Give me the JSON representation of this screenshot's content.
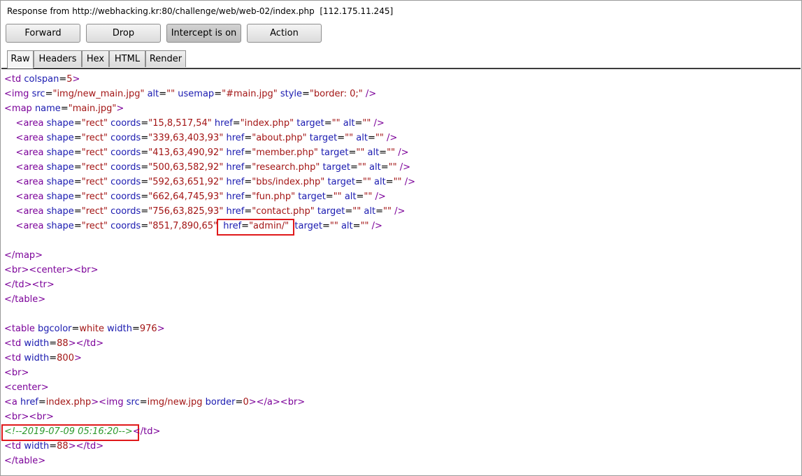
{
  "header": {
    "title": "Response from http://webhacking.kr:80/challenge/web/web-02/index.php  [112.175.11.245]"
  },
  "toolbar": {
    "forward": "Forward",
    "drop": "Drop",
    "intercept": "Intercept is on",
    "action": "Action"
  },
  "tabs": [
    "Raw",
    "Headers",
    "Hex",
    "HTML",
    "Render"
  ],
  "active_tab": "Raw",
  "colors": {
    "tag": "#7b0099",
    "attr_name": "#1a1ab0",
    "attr_value": "#a31515",
    "comment": "#2e9a2e",
    "highlight_border": "#e0191b"
  },
  "code_lines": [
    [
      [
        "tg",
        "<"
      ],
      [
        "tg",
        "td"
      ],
      [
        "tx",
        " "
      ],
      [
        "an",
        "colspan"
      ],
      [
        "tx",
        "="
      ],
      [
        "av",
        "5"
      ],
      [
        "tg",
        ">"
      ]
    ],
    [
      [
        "tg",
        "<"
      ],
      [
        "tg",
        "img"
      ],
      [
        "tx",
        " "
      ],
      [
        "an",
        "src"
      ],
      [
        "tx",
        "="
      ],
      [
        "av",
        "\"img/new_main.jpg\""
      ],
      [
        "tx",
        " "
      ],
      [
        "an",
        "alt"
      ],
      [
        "tx",
        "="
      ],
      [
        "av",
        "\"\""
      ],
      [
        "tx",
        " "
      ],
      [
        "an",
        "usemap"
      ],
      [
        "tx",
        "="
      ],
      [
        "av",
        "\"#main.jpg\""
      ],
      [
        "tx",
        " "
      ],
      [
        "an",
        "style"
      ],
      [
        "tx",
        "="
      ],
      [
        "av",
        "\"border: 0;\""
      ],
      [
        "tx",
        " "
      ],
      [
        "tg",
        "/>"
      ]
    ],
    [
      [
        "tg",
        "<"
      ],
      [
        "tg",
        "map"
      ],
      [
        "tx",
        " "
      ],
      [
        "an",
        "name"
      ],
      [
        "tx",
        "="
      ],
      [
        "av",
        "\"main.jpg\""
      ],
      [
        "tg",
        ">"
      ]
    ],
    [
      [
        "tx",
        "    "
      ],
      [
        "tg",
        "<"
      ],
      [
        "tg",
        "area"
      ],
      [
        "tx",
        " "
      ],
      [
        "an",
        "shape"
      ],
      [
        "tx",
        "="
      ],
      [
        "av",
        "\"rect\""
      ],
      [
        "tx",
        " "
      ],
      [
        "an",
        "coords"
      ],
      [
        "tx",
        "="
      ],
      [
        "av",
        "\"15,8,517,54\""
      ],
      [
        "tx",
        " "
      ],
      [
        "an",
        "href"
      ],
      [
        "tx",
        "="
      ],
      [
        "av",
        "\"index.php\""
      ],
      [
        "tx",
        " "
      ],
      [
        "an",
        "target"
      ],
      [
        "tx",
        "="
      ],
      [
        "av",
        "\"\""
      ],
      [
        "tx",
        " "
      ],
      [
        "an",
        "alt"
      ],
      [
        "tx",
        "="
      ],
      [
        "av",
        "\"\""
      ],
      [
        "tx",
        " "
      ],
      [
        "tg",
        "/>"
      ]
    ],
    [
      [
        "tx",
        "    "
      ],
      [
        "tg",
        "<"
      ],
      [
        "tg",
        "area"
      ],
      [
        "tx",
        " "
      ],
      [
        "an",
        "shape"
      ],
      [
        "tx",
        "="
      ],
      [
        "av",
        "\"rect\""
      ],
      [
        "tx",
        " "
      ],
      [
        "an",
        "coords"
      ],
      [
        "tx",
        "="
      ],
      [
        "av",
        "\"339,63,403,93\""
      ],
      [
        "tx",
        " "
      ],
      [
        "an",
        "href"
      ],
      [
        "tx",
        "="
      ],
      [
        "av",
        "\"about.php\""
      ],
      [
        "tx",
        " "
      ],
      [
        "an",
        "target"
      ],
      [
        "tx",
        "="
      ],
      [
        "av",
        "\"\""
      ],
      [
        "tx",
        " "
      ],
      [
        "an",
        "alt"
      ],
      [
        "tx",
        "="
      ],
      [
        "av",
        "\"\""
      ],
      [
        "tx",
        " "
      ],
      [
        "tg",
        "/>"
      ]
    ],
    [
      [
        "tx",
        "    "
      ],
      [
        "tg",
        "<"
      ],
      [
        "tg",
        "area"
      ],
      [
        "tx",
        " "
      ],
      [
        "an",
        "shape"
      ],
      [
        "tx",
        "="
      ],
      [
        "av",
        "\"rect\""
      ],
      [
        "tx",
        " "
      ],
      [
        "an",
        "coords"
      ],
      [
        "tx",
        "="
      ],
      [
        "av",
        "\"413,63,490,92\""
      ],
      [
        "tx",
        " "
      ],
      [
        "an",
        "href"
      ],
      [
        "tx",
        "="
      ],
      [
        "av",
        "\"member.php\""
      ],
      [
        "tx",
        " "
      ],
      [
        "an",
        "target"
      ],
      [
        "tx",
        "="
      ],
      [
        "av",
        "\"\""
      ],
      [
        "tx",
        " "
      ],
      [
        "an",
        "alt"
      ],
      [
        "tx",
        "="
      ],
      [
        "av",
        "\"\""
      ],
      [
        "tx",
        " "
      ],
      [
        "tg",
        "/>"
      ]
    ],
    [
      [
        "tx",
        "    "
      ],
      [
        "tg",
        "<"
      ],
      [
        "tg",
        "area"
      ],
      [
        "tx",
        " "
      ],
      [
        "an",
        "shape"
      ],
      [
        "tx",
        "="
      ],
      [
        "av",
        "\"rect\""
      ],
      [
        "tx",
        " "
      ],
      [
        "an",
        "coords"
      ],
      [
        "tx",
        "="
      ],
      [
        "av",
        "\"500,63,582,92\""
      ],
      [
        "tx",
        " "
      ],
      [
        "an",
        "href"
      ],
      [
        "tx",
        "="
      ],
      [
        "av",
        "\"research.php\""
      ],
      [
        "tx",
        " "
      ],
      [
        "an",
        "target"
      ],
      [
        "tx",
        "="
      ],
      [
        "av",
        "\"\""
      ],
      [
        "tx",
        " "
      ],
      [
        "an",
        "alt"
      ],
      [
        "tx",
        "="
      ],
      [
        "av",
        "\"\""
      ],
      [
        "tx",
        " "
      ],
      [
        "tg",
        "/>"
      ]
    ],
    [
      [
        "tx",
        "    "
      ],
      [
        "tg",
        "<"
      ],
      [
        "tg",
        "area"
      ],
      [
        "tx",
        " "
      ],
      [
        "an",
        "shape"
      ],
      [
        "tx",
        "="
      ],
      [
        "av",
        "\"rect\""
      ],
      [
        "tx",
        " "
      ],
      [
        "an",
        "coords"
      ],
      [
        "tx",
        "="
      ],
      [
        "av",
        "\"592,63,651,92\""
      ],
      [
        "tx",
        " "
      ],
      [
        "an",
        "href"
      ],
      [
        "tx",
        "="
      ],
      [
        "av",
        "\"bbs/index.php\""
      ],
      [
        "tx",
        " "
      ],
      [
        "an",
        "target"
      ],
      [
        "tx",
        "="
      ],
      [
        "av",
        "\"\""
      ],
      [
        "tx",
        " "
      ],
      [
        "an",
        "alt"
      ],
      [
        "tx",
        "="
      ],
      [
        "av",
        "\"\""
      ],
      [
        "tx",
        " "
      ],
      [
        "tg",
        "/>"
      ]
    ],
    [
      [
        "tx",
        "    "
      ],
      [
        "tg",
        "<"
      ],
      [
        "tg",
        "area"
      ],
      [
        "tx",
        " "
      ],
      [
        "an",
        "shape"
      ],
      [
        "tx",
        "="
      ],
      [
        "av",
        "\"rect\""
      ],
      [
        "tx",
        " "
      ],
      [
        "an",
        "coords"
      ],
      [
        "tx",
        "="
      ],
      [
        "av",
        "\"662,64,745,93\""
      ],
      [
        "tx",
        " "
      ],
      [
        "an",
        "href"
      ],
      [
        "tx",
        "="
      ],
      [
        "av",
        "\"fun.php\""
      ],
      [
        "tx",
        " "
      ],
      [
        "an",
        "target"
      ],
      [
        "tx",
        "="
      ],
      [
        "av",
        "\"\""
      ],
      [
        "tx",
        " "
      ],
      [
        "an",
        "alt"
      ],
      [
        "tx",
        "="
      ],
      [
        "av",
        "\"\""
      ],
      [
        "tx",
        " "
      ],
      [
        "tg",
        "/>"
      ]
    ],
    [
      [
        "tx",
        "    "
      ],
      [
        "tg",
        "<"
      ],
      [
        "tg",
        "area"
      ],
      [
        "tx",
        " "
      ],
      [
        "an",
        "shape"
      ],
      [
        "tx",
        "="
      ],
      [
        "av",
        "\"rect\""
      ],
      [
        "tx",
        " "
      ],
      [
        "an",
        "coords"
      ],
      [
        "tx",
        "="
      ],
      [
        "av",
        "\"756,63,825,93\""
      ],
      [
        "tx",
        " "
      ],
      [
        "an",
        "href"
      ],
      [
        "tx",
        "="
      ],
      [
        "av",
        "\"contact.php\""
      ],
      [
        "tx",
        " "
      ],
      [
        "an",
        "target"
      ],
      [
        "tx",
        "="
      ],
      [
        "av",
        "\"\""
      ],
      [
        "tx",
        " "
      ],
      [
        "an",
        "alt"
      ],
      [
        "tx",
        "="
      ],
      [
        "av",
        "\"\""
      ],
      [
        "tx",
        " "
      ],
      [
        "tg",
        "/>"
      ]
    ],
    [
      [
        "tx",
        "    "
      ],
      [
        "tg",
        "<"
      ],
      [
        "tg",
        "area"
      ],
      [
        "tx",
        " "
      ],
      [
        "an",
        "shape"
      ],
      [
        "tx",
        "="
      ],
      [
        "av",
        "\"rect\""
      ],
      [
        "tx",
        " "
      ],
      [
        "an",
        "coords"
      ],
      [
        "tx",
        "="
      ],
      [
        "av",
        "\"851,7,890,65\""
      ],
      [
        "tx",
        "  "
      ],
      [
        "an",
        "href"
      ],
      [
        "tx",
        "="
      ],
      [
        "av",
        "\"admin/\""
      ],
      [
        "tx",
        "  "
      ],
      [
        "an",
        "target"
      ],
      [
        "tx",
        "="
      ],
      [
        "av",
        "\"\""
      ],
      [
        "tx",
        " "
      ],
      [
        "an",
        "alt"
      ],
      [
        "tx",
        "="
      ],
      [
        "av",
        "\"\""
      ],
      [
        "tx",
        " "
      ],
      [
        "tg",
        "/>"
      ]
    ],
    [],
    [
      [
        "tg",
        "</"
      ],
      [
        "tg",
        "map"
      ],
      [
        "tg",
        ">"
      ]
    ],
    [
      [
        "tg",
        "<"
      ],
      [
        "tg",
        "br"
      ],
      [
        "tg",
        ">"
      ],
      [
        "tg",
        "<"
      ],
      [
        "tg",
        "center"
      ],
      [
        "tg",
        ">"
      ],
      [
        "tg",
        "<"
      ],
      [
        "tg",
        "br"
      ],
      [
        "tg",
        ">"
      ]
    ],
    [
      [
        "tg",
        "</"
      ],
      [
        "tg",
        "td"
      ],
      [
        "tg",
        ">"
      ],
      [
        "tg",
        "<"
      ],
      [
        "tg",
        "tr"
      ],
      [
        "tg",
        ">"
      ]
    ],
    [
      [
        "tg",
        "</"
      ],
      [
        "tg",
        "table"
      ],
      [
        "tg",
        ">"
      ]
    ],
    [],
    [
      [
        "tg",
        "<"
      ],
      [
        "tg",
        "table"
      ],
      [
        "tx",
        " "
      ],
      [
        "an",
        "bgcolor"
      ],
      [
        "tx",
        "="
      ],
      [
        "av",
        "white"
      ],
      [
        "tx",
        " "
      ],
      [
        "an",
        "width"
      ],
      [
        "tx",
        "="
      ],
      [
        "av",
        "976"
      ],
      [
        "tg",
        ">"
      ]
    ],
    [
      [
        "tg",
        "<"
      ],
      [
        "tg",
        "td"
      ],
      [
        "tx",
        " "
      ],
      [
        "an",
        "width"
      ],
      [
        "tx",
        "="
      ],
      [
        "av",
        "88"
      ],
      [
        "tg",
        ">"
      ],
      [
        "tg",
        "</"
      ],
      [
        "tg",
        "td"
      ],
      [
        "tg",
        ">"
      ]
    ],
    [
      [
        "tg",
        "<"
      ],
      [
        "tg",
        "td"
      ],
      [
        "tx",
        " "
      ],
      [
        "an",
        "width"
      ],
      [
        "tx",
        "="
      ],
      [
        "av",
        "800"
      ],
      [
        "tg",
        ">"
      ]
    ],
    [
      [
        "tg",
        "<"
      ],
      [
        "tg",
        "br"
      ],
      [
        "tg",
        ">"
      ]
    ],
    [
      [
        "tg",
        "<"
      ],
      [
        "tg",
        "center"
      ],
      [
        "tg",
        ">"
      ]
    ],
    [
      [
        "tg",
        "<"
      ],
      [
        "tg",
        "a"
      ],
      [
        "tx",
        " "
      ],
      [
        "an",
        "href"
      ],
      [
        "tx",
        "="
      ],
      [
        "av",
        "index.php"
      ],
      [
        "tg",
        ">"
      ],
      [
        "tg",
        "<"
      ],
      [
        "tg",
        "img"
      ],
      [
        "tx",
        " "
      ],
      [
        "an",
        "src"
      ],
      [
        "tx",
        "="
      ],
      [
        "av",
        "img/new.jpg"
      ],
      [
        "tx",
        " "
      ],
      [
        "an",
        "border"
      ],
      [
        "tx",
        "="
      ],
      [
        "av",
        "0"
      ],
      [
        "tg",
        ">"
      ],
      [
        "tg",
        "</"
      ],
      [
        "tg",
        "a"
      ],
      [
        "tg",
        ">"
      ],
      [
        "tg",
        "<"
      ],
      [
        "tg",
        "br"
      ],
      [
        "tg",
        ">"
      ]
    ],
    [
      [
        "tg",
        "<"
      ],
      [
        "tg",
        "br"
      ],
      [
        "tg",
        ">"
      ],
      [
        "tg",
        "<"
      ],
      [
        "tg",
        "br"
      ],
      [
        "tg",
        ">"
      ]
    ],
    [
      [
        "cm",
        "<!--2019-07-09 05:16:20-->"
      ],
      [
        "tg",
        "</"
      ],
      [
        "tg",
        "td"
      ],
      [
        "tg",
        ">"
      ]
    ],
    [
      [
        "tg",
        "<"
      ],
      [
        "tg",
        "td"
      ],
      [
        "tx",
        " "
      ],
      [
        "an",
        "width"
      ],
      [
        "tx",
        "="
      ],
      [
        "av",
        "88"
      ],
      [
        "tg",
        ">"
      ],
      [
        "tg",
        "</"
      ],
      [
        "tg",
        "td"
      ],
      [
        "tg",
        ">"
      ]
    ],
    [
      [
        "tg",
        "</"
      ],
      [
        "tg",
        "table"
      ],
      [
        "tg",
        ">"
      ]
    ]
  ]
}
